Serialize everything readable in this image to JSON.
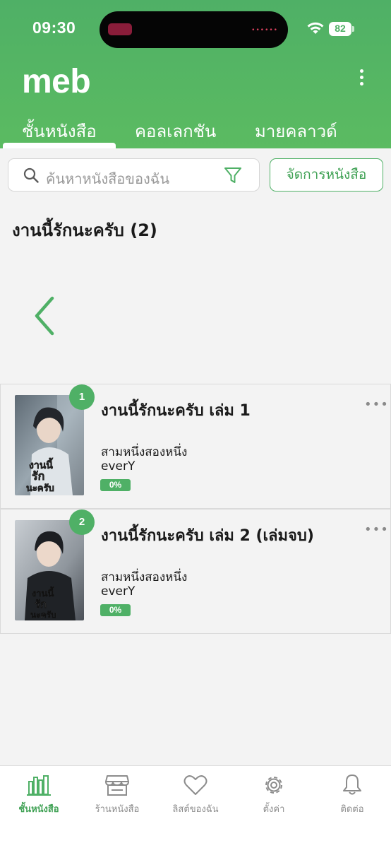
{
  "status_bar": {
    "time": "09:30",
    "battery": "82"
  },
  "app": {
    "title": "meb"
  },
  "tabs": [
    {
      "label": "ชั้นหนังสือ",
      "active": true
    },
    {
      "label": "คอลเลกชัน",
      "active": false
    },
    {
      "label": "มายคลาวด์",
      "active": false
    }
  ],
  "search": {
    "placeholder": "ค้นหาหนังสือของฉัน"
  },
  "manage_button": {
    "label": "จัดการหนังสือ"
  },
  "series": {
    "title": "งานนี้รักนะครับ  (2)"
  },
  "books": [
    {
      "index": "1",
      "title": "งานนี้รักนะครับ เล่ม 1",
      "author": "สามหนึ่งสองหนึ่ง",
      "publisher": "everY",
      "progress": "0%"
    },
    {
      "index": "2",
      "title": "งานนี้รักนะครับ เล่ม 2 (เล่มจบ)",
      "author": "สามหนึ่งสองหนึ่ง",
      "publisher": "everY",
      "progress": "0%"
    }
  ],
  "bottom_nav": [
    {
      "label": "ชั้นหนังสือ",
      "icon": "bookshelf-icon",
      "active": true
    },
    {
      "label": "ร้านหนังสือ",
      "icon": "store-icon",
      "active": false
    },
    {
      "label": "ลิสต์ของฉัน",
      "icon": "heart-icon",
      "active": false
    },
    {
      "label": "ตั้งค่า",
      "icon": "gear-icon",
      "active": false
    },
    {
      "label": "ติดต่อ",
      "icon": "bell-icon",
      "active": false
    }
  ],
  "colors": {
    "accent": "#4fb066",
    "nav_inactive": "#8c8c8c",
    "background": "#f3f3f3"
  }
}
